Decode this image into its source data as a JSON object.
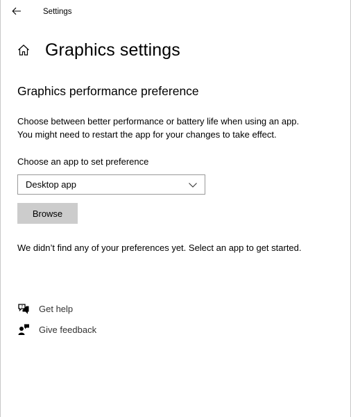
{
  "titlebar": {
    "back_icon": "back-arrow-icon",
    "title": "Settings"
  },
  "header": {
    "home_icon": "home-icon",
    "title": "Graphics settings"
  },
  "section": {
    "title": "Graphics performance preference",
    "description_line1": "Choose between better performance or battery life when using an app.",
    "description_line2": "You might need to restart the app for your changes to take effect."
  },
  "app_picker": {
    "label": "Choose an app to set preference",
    "selected": "Desktop app",
    "browse_label": "Browse"
  },
  "empty_state": "We didn’t find any of your preferences yet. Select an app to get started.",
  "links": [
    {
      "icon": "get-help-icon",
      "label": "Get help"
    },
    {
      "icon": "give-feedback-icon",
      "label": "Give feedback"
    }
  ],
  "colors": {
    "button_bg": "#cccccc",
    "dropdown_border": "#999999",
    "link_text": "#333333"
  }
}
